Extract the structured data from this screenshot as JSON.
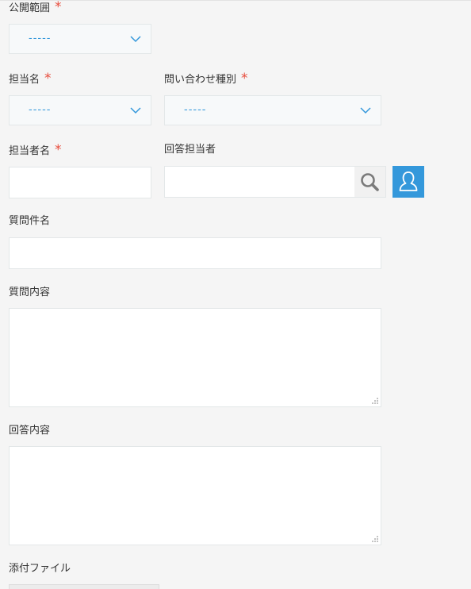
{
  "form": {
    "visibility": {
      "label": "公開範囲",
      "required_mark": "*",
      "selected": "-----"
    },
    "person_in_charge_name": {
      "label": "担当名",
      "required_mark": "*",
      "selected": "-----"
    },
    "inquiry_type": {
      "label": "問い合わせ種別",
      "required_mark": "*",
      "selected": "-----"
    },
    "assignee_name": {
      "label": "担当者名",
      "required_mark": "*",
      "value": ""
    },
    "responder": {
      "label": "回答担当者",
      "value": "",
      "search_icon": "search-icon",
      "user_icon": "user-icon"
    },
    "question_title": {
      "label": "質問件名",
      "value": ""
    },
    "question_content": {
      "label": "質問内容",
      "value": ""
    },
    "answer_content": {
      "label": "回答内容",
      "value": ""
    },
    "attachment": {
      "label": "添付ファイル"
    }
  },
  "colors": {
    "required": "#e74c3c",
    "accent": "#3498db",
    "background": "#f5f5f5"
  }
}
